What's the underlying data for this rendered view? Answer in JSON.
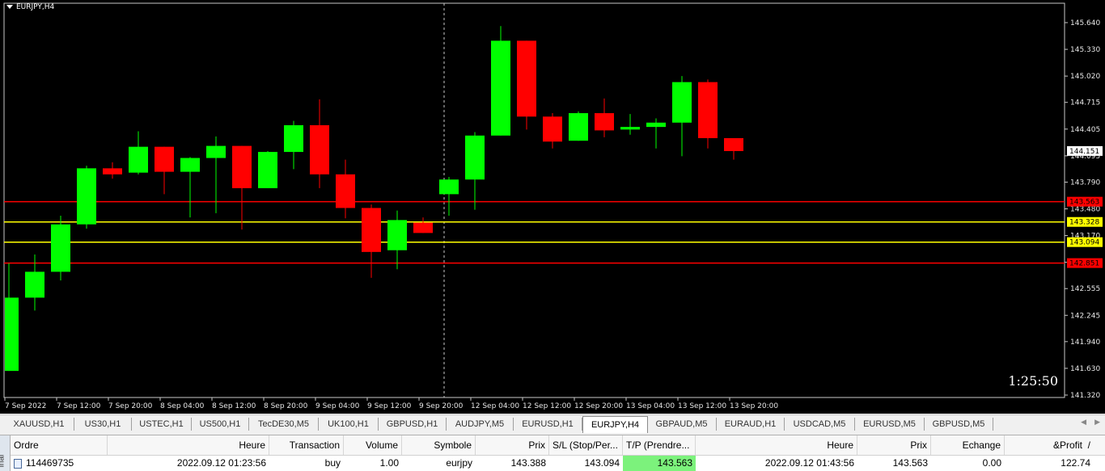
{
  "chart": {
    "symbol": "EURJPY,H4",
    "countdown": "1:25:50",
    "current_price": "144.151",
    "colors": {
      "bull": "#00ff00",
      "bear": "#ff0000",
      "bg": "#000000",
      "ask_line": "#ffff00",
      "level_line": "#ff0000"
    },
    "price_axis": {
      "min": 141.32,
      "max": 145.64,
      "ticks": [
        "145.640",
        "145.330",
        "145.020",
        "144.715",
        "144.405",
        "144.095",
        "143.790",
        "143.480",
        "143.170",
        "142.860",
        "142.555",
        "142.245",
        "141.940",
        "141.630",
        "141.320"
      ]
    },
    "time_axis": [
      "7 Sep 2022",
      "7 Sep 12:00",
      "7 Sep 20:00",
      "8 Sep 04:00",
      "8 Sep 12:00",
      "8 Sep 20:00",
      "9 Sep 04:00",
      "9 Sep 12:00",
      "9 Sep 20:00",
      "12 Sep 04:00",
      "12 Sep 12:00",
      "12 Sep 20:00",
      "13 Sep 04:00",
      "13 Sep 12:00",
      "13 Sep 20:00"
    ],
    "levels": [
      {
        "label": "143.563",
        "price": 143.563,
        "type": "tp"
      },
      {
        "label": "143.328",
        "price": 143.328,
        "type": "ask"
      },
      {
        "label": "143.094",
        "price": 143.094,
        "type": "sl"
      },
      {
        "label": "142.851",
        "price": 142.851,
        "type": "level"
      }
    ]
  },
  "chart_data": {
    "type": "candlestick",
    "ylim": [
      141.32,
      145.64
    ],
    "candles": [
      {
        "o": 141.6,
        "h": 142.85,
        "l": 141.6,
        "c": 142.45
      },
      {
        "o": 142.45,
        "h": 142.95,
        "l": 142.3,
        "c": 142.75
      },
      {
        "o": 142.75,
        "h": 143.4,
        "l": 142.65,
        "c": 143.3
      },
      {
        "o": 143.3,
        "h": 143.98,
        "l": 143.25,
        "c": 143.95
      },
      {
        "o": 143.95,
        "h": 144.02,
        "l": 143.83,
        "c": 143.88
      },
      {
        "o": 143.9,
        "h": 144.38,
        "l": 143.88,
        "c": 144.2
      },
      {
        "o": 144.2,
        "h": 144.2,
        "l": 143.65,
        "c": 143.91
      },
      {
        "o": 143.91,
        "h": 144.08,
        "l": 143.38,
        "c": 144.07
      },
      {
        "o": 144.07,
        "h": 144.32,
        "l": 143.43,
        "c": 144.21
      },
      {
        "o": 144.21,
        "h": 144.21,
        "l": 143.24,
        "c": 143.72
      },
      {
        "o": 143.72,
        "h": 144.15,
        "l": 143.72,
        "c": 144.14
      },
      {
        "o": 144.14,
        "h": 144.5,
        "l": 143.94,
        "c": 144.45
      },
      {
        "o": 144.45,
        "h": 144.75,
        "l": 143.72,
        "c": 143.88
      },
      {
        "o": 143.88,
        "h": 144.05,
        "l": 143.37,
        "c": 143.49
      },
      {
        "o": 143.49,
        "h": 143.53,
        "l": 142.68,
        "c": 142.98
      },
      {
        "o": 143.0,
        "h": 143.46,
        "l": 142.78,
        "c": 143.35
      },
      {
        "o": 143.32,
        "h": 143.38,
        "l": 143.2,
        "c": 143.2
      },
      {
        "o": 143.65,
        "h": 143.85,
        "l": 143.4,
        "c": 143.82
      },
      {
        "o": 143.82,
        "h": 144.37,
        "l": 143.47,
        "c": 144.33
      },
      {
        "o": 144.33,
        "h": 145.6,
        "l": 144.33,
        "c": 145.43
      },
      {
        "o": 145.43,
        "h": 145.43,
        "l": 144.4,
        "c": 144.55
      },
      {
        "o": 144.55,
        "h": 144.59,
        "l": 144.18,
        "c": 144.26
      },
      {
        "o": 144.27,
        "h": 144.61,
        "l": 144.27,
        "c": 144.59
      },
      {
        "o": 144.59,
        "h": 144.76,
        "l": 144.31,
        "c": 144.39
      },
      {
        "o": 144.4,
        "h": 144.58,
        "l": 144.34,
        "c": 144.43
      },
      {
        "o": 144.43,
        "h": 144.53,
        "l": 144.18,
        "c": 144.48
      },
      {
        "o": 144.48,
        "h": 145.02,
        "l": 144.09,
        "c": 144.95
      },
      {
        "o": 144.95,
        "h": 144.98,
        "l": 144.18,
        "c": 144.3
      },
      {
        "o": 144.3,
        "h": 144.3,
        "l": 144.05,
        "c": 144.15
      }
    ]
  },
  "tabs": [
    "XAUUSD,H1",
    "US30,H1",
    "USTEC,H1",
    "US500,H1",
    "TecDE30,M5",
    "UK100,H1",
    "GBPUSD,H1",
    "AUDJPY,M5",
    "EURUSD,H1",
    "EURJPY,H4",
    "GBPAUD,M5",
    "EURAUD,H1",
    "USDCAD,M5",
    "EURUSD,M5",
    "GBPUSD,M5"
  ],
  "active_tab": "EURJPY,H4",
  "terminal": {
    "side_label": "inal",
    "headers": {
      "ordre": "Ordre",
      "heure": "Heure",
      "transaction": "Transaction",
      "volume": "Volume",
      "symbole": "Symbole",
      "prix": "Prix",
      "sl": "S/L (Stop/Per...",
      "tp": "T/P (Prendre...",
      "heure2": "Heure",
      "prix2": "Prix",
      "echange": "Echange",
      "profit": "&Profit",
      "profit_sep": "/"
    },
    "row": {
      "ordre": "114469735",
      "heure": "2022.09.12 01:23:56",
      "transaction": "buy",
      "volume": "1.00",
      "symbole": "eurjpy",
      "prix": "143.388",
      "sl": "143.094",
      "tp": "143.563",
      "heure2": "2022.09.12 01:43:56",
      "prix2": "143.563",
      "echange": "0.00",
      "profit": "122.74"
    }
  }
}
